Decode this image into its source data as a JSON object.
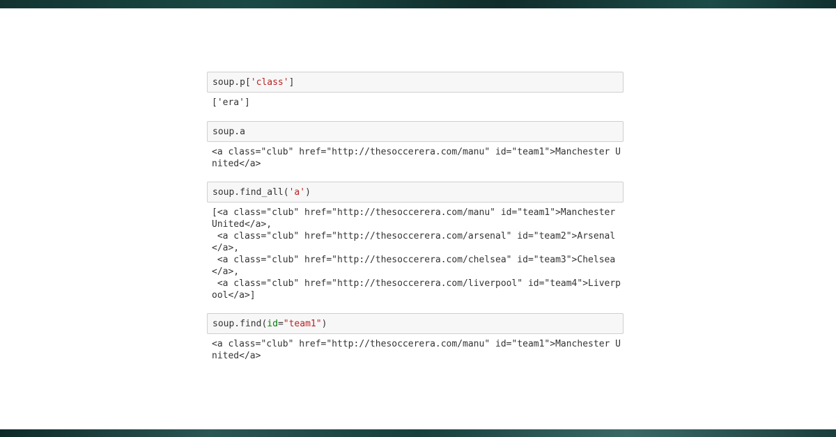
{
  "cells": [
    {
      "input": {
        "pre": "soup.p[",
        "str": "'class'",
        "post": "]"
      },
      "output": "['era']"
    },
    {
      "input": {
        "text": "soup.a"
      },
      "output": "<a class=\"club\" href=\"http://thesoccerera.com/manu\" id=\"team1\">Manchester U\nnited</a>"
    },
    {
      "input": {
        "pre": "soup.find_all(",
        "str": "'a'",
        "post": ")"
      },
      "output": "[<a class=\"club\" href=\"http://thesoccerera.com/manu\" id=\"team1\">Manchester\nUnited</a>,\n <a class=\"club\" href=\"http://thesoccerera.com/arsenal\" id=\"team2\">Arsenal\n</a>,\n <a class=\"club\" href=\"http://thesoccerera.com/chelsea\" id=\"team3\">Chelsea\n</a>,\n <a class=\"club\" href=\"http://thesoccerera.com/liverpool\" id=\"team4\">Liverp\nool</a>]"
    },
    {
      "input": {
        "pre": "soup.find(",
        "arg": "id",
        "eq": "=",
        "str": "\"team1\"",
        "post": ")"
      },
      "output": "<a class=\"club\" href=\"http://thesoccerera.com/manu\" id=\"team1\">Manchester U\nnited</a>"
    }
  ]
}
